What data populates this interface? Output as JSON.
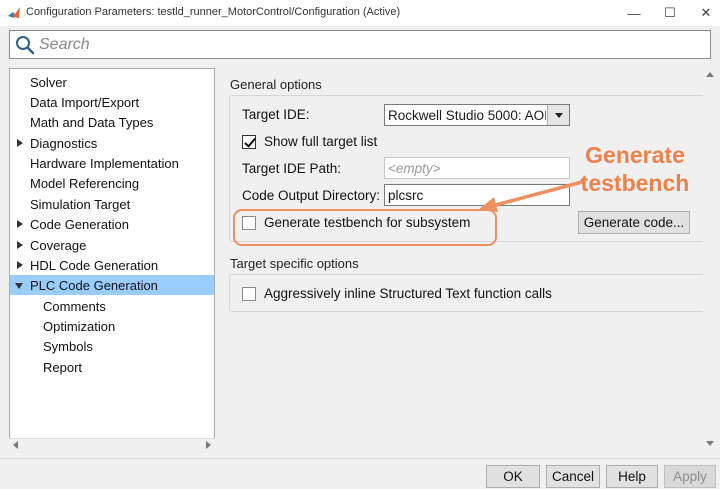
{
  "window": {
    "title": "Configuration Parameters: testld_runner_MotorControl/Configuration (Active)",
    "controls": {
      "minimize": "—",
      "maximize": "☐",
      "close": "✕"
    }
  },
  "search": {
    "placeholder": "Search"
  },
  "tree": {
    "items": [
      {
        "label": "Solver",
        "level": 0,
        "expander": "none",
        "selected": false
      },
      {
        "label": "Data Import/Export",
        "level": 0,
        "expander": "none",
        "selected": false
      },
      {
        "label": "Math and Data Types",
        "level": 0,
        "expander": "none",
        "selected": false
      },
      {
        "label": "Diagnostics",
        "level": 0,
        "expander": "collapsed",
        "selected": false
      },
      {
        "label": "Hardware Implementation",
        "level": 0,
        "expander": "none",
        "selected": false
      },
      {
        "label": "Model Referencing",
        "level": 0,
        "expander": "none",
        "selected": false
      },
      {
        "label": "Simulation Target",
        "level": 0,
        "expander": "none",
        "selected": false
      },
      {
        "label": "Code Generation",
        "level": 0,
        "expander": "collapsed",
        "selected": false
      },
      {
        "label": "Coverage",
        "level": 0,
        "expander": "collapsed",
        "selected": false
      },
      {
        "label": "HDL Code Generation",
        "level": 0,
        "expander": "collapsed",
        "selected": false
      },
      {
        "label": "PLC Code Generation",
        "level": 0,
        "expander": "expanded",
        "selected": true
      },
      {
        "label": "Comments",
        "level": 1,
        "expander": "none",
        "selected": false
      },
      {
        "label": "Optimization",
        "level": 1,
        "expander": "none",
        "selected": false
      },
      {
        "label": "Symbols",
        "level": 1,
        "expander": "none",
        "selected": false
      },
      {
        "label": "Report",
        "level": 1,
        "expander": "none",
        "selected": false
      }
    ]
  },
  "general": {
    "title": "General options",
    "target_ide_label": "Target IDE:",
    "target_ide_value": "Rockwell Studio 5000: AOI",
    "show_full_list_label": "Show full target list",
    "show_full_list_checked": true,
    "target_ide_path_label": "Target IDE Path:",
    "target_ide_path_placeholder": "<empty>",
    "code_output_dir_label": "Code Output Directory:",
    "code_output_dir_value": "plcsrc",
    "generate_testbench_label": "Generate testbench for subsystem",
    "generate_testbench_checked": false,
    "generate_code_button": "Generate code..."
  },
  "target_specific": {
    "title": "Target specific options",
    "inline_label": "Aggressively inline Structured Text function calls",
    "inline_checked": false
  },
  "annotation": {
    "callout_line1": "Generate",
    "callout_line2": "testbench",
    "color": "#f0804a"
  },
  "footer": {
    "ok": "OK",
    "cancel": "Cancel",
    "help": "Help",
    "apply": "Apply"
  },
  "colors": {
    "selection": "#99ccff",
    "annotation": "#f0804a"
  }
}
